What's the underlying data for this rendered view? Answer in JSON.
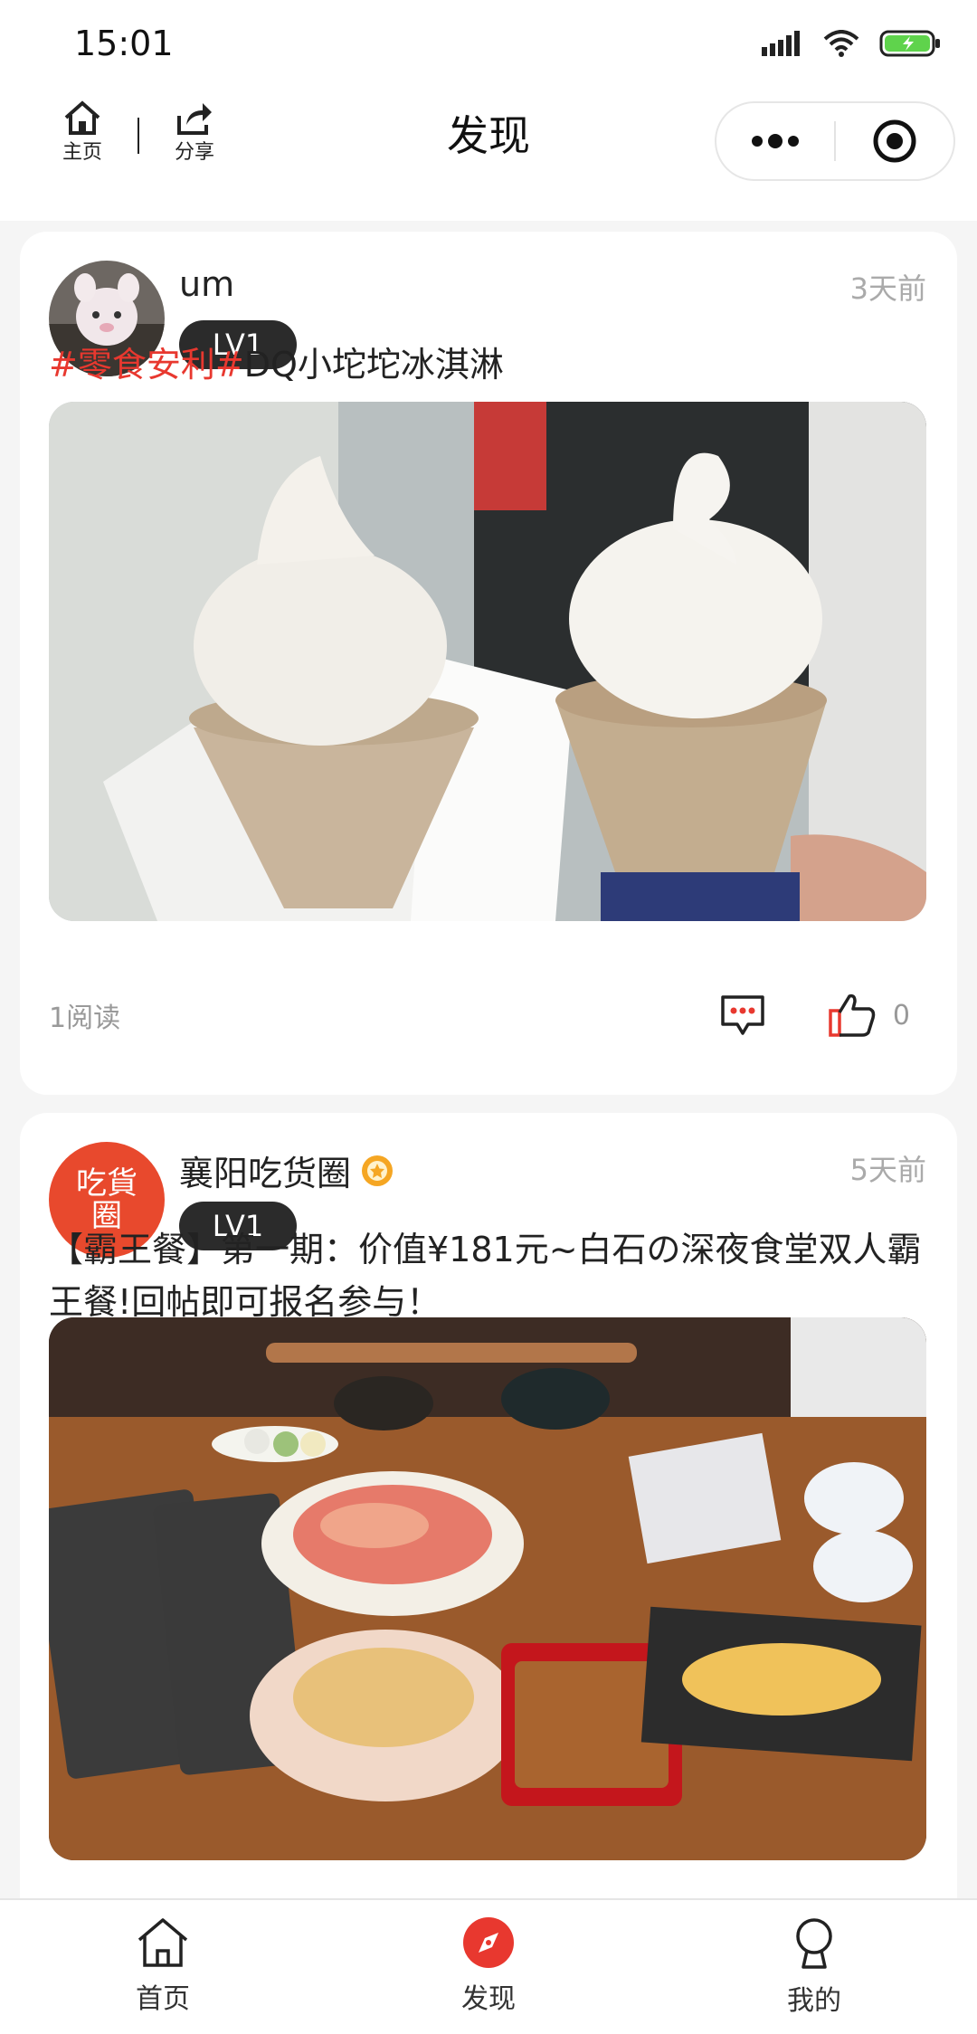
{
  "status_bar": {
    "time": "15:01"
  },
  "nav": {
    "title": "发现",
    "home_label": "主页",
    "share_label": "分享"
  },
  "posts": [
    {
      "username": "um",
      "level": "LV1",
      "time": "3天前",
      "tags": [
        "#零食安利",
        "#"
      ],
      "title_text": "DQ小坨坨冰淇淋",
      "reads": "1阅读",
      "likes": "0"
    },
    {
      "username": "襄阳吃货圈",
      "level": "LV1",
      "time": "5天前",
      "avatar_text": "吃貨圈",
      "title_text": "【霸王餐】第一期：价值¥181元~白石の深夜食堂双人霸王餐!回帖即可报名参与！"
    }
  ],
  "tabs": [
    {
      "label": "首页",
      "icon": "home-icon"
    },
    {
      "label": "发现",
      "icon": "compass-icon",
      "active": true
    },
    {
      "label": "我的",
      "icon": "user-icon"
    }
  ],
  "colors": {
    "accent": "#e8382f",
    "battery": "#5fd34c"
  }
}
